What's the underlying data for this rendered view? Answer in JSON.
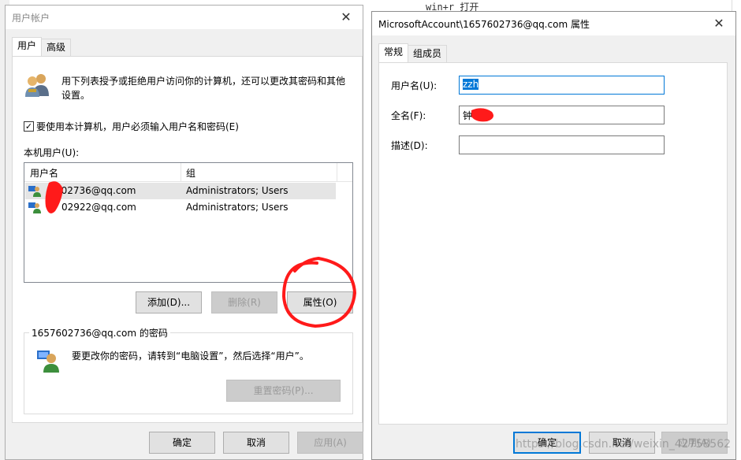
{
  "background": {
    "snippet": "win+r  打开"
  },
  "accounts_window": {
    "title": "用户帐户",
    "tabs": [
      "用户",
      "高级"
    ],
    "intro_text_1": "用下列表授予或拒绝用户访问你的计算机，还可以更改其密码和其他",
    "intro_text_2": "设置。",
    "require_login_label": "要使用本计算机，用户必须输入用户名和密码(E)",
    "require_login_checked": true,
    "local_users_label": "本机用户(U):",
    "columns": [
      "用户名",
      "组"
    ],
    "users": [
      {
        "name": "1657602736@qq.com",
        "name_visible": "602736@qq.com",
        "group": "Administrators; Users"
      },
      {
        "name": "02922@qq.com",
        "name_visible": "02922@qq.com",
        "group": "Administrators; Users"
      }
    ],
    "buttons": {
      "add": "添加(D)...",
      "remove": "删除(R)",
      "properties": "属性(O)"
    },
    "password_group_title": "1657602736@qq.com 的密码",
    "password_text": "要更改你的密码，请转到“电脑设置”，然后选择“用户”。",
    "reset_password": "重置密码(P)...",
    "footer": {
      "ok": "确定",
      "cancel": "取消",
      "apply": "应用(A)"
    }
  },
  "properties_window": {
    "title": "MicrosoftAccount\\1657602736@qq.com 属性",
    "tabs": [
      "常规",
      "组成员"
    ],
    "fields": {
      "username_label": "用户名(U):",
      "username_value": "zzh",
      "fullname_label": "全名(F):",
      "fullname_value": "钟",
      "description_label": "描述(D):",
      "description_value": ""
    },
    "footer": {
      "ok": "确定",
      "cancel": "取消",
      "apply": "应用(A)"
    }
  },
  "watermark": "https://blog.csdn.net/weixin_42758562",
  "colors": {
    "accent": "#0078d7",
    "annotation_red": "#ff1a1a"
  }
}
